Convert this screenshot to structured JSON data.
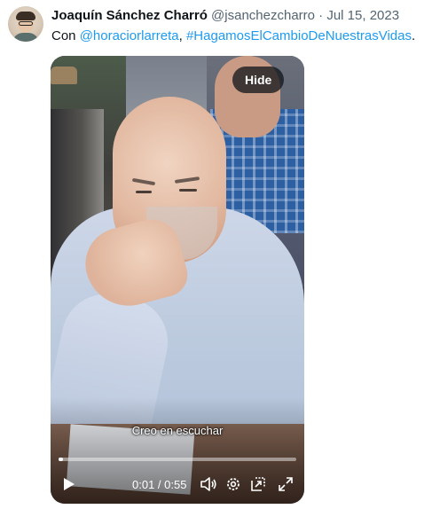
{
  "tweet": {
    "author_name": "Joaquín Sánchez Charró",
    "author_handle": "@jsanchezcharro",
    "separator": " · ",
    "date": "Jul 15, 2023",
    "text_prefix": "Con ",
    "mention": "@horaciorlarreta",
    "text_separator": ", ",
    "hashtag": "#HagamosElCambioDeNuestrasVidas",
    "text_suffix": "."
  },
  "video": {
    "hide_label": "Hide",
    "caption": "Creo en escuchar",
    "current_time": "0:01",
    "time_separator": " / ",
    "duration": "0:55",
    "progress_fraction": 0.02,
    "icons": [
      "play-icon",
      "volume-icon",
      "settings-icon",
      "picture-in-picture-icon",
      "fullscreen-icon"
    ]
  },
  "colors": {
    "link": "#1d9bf0",
    "meta_text": "#536471",
    "text": "#0f1419"
  }
}
